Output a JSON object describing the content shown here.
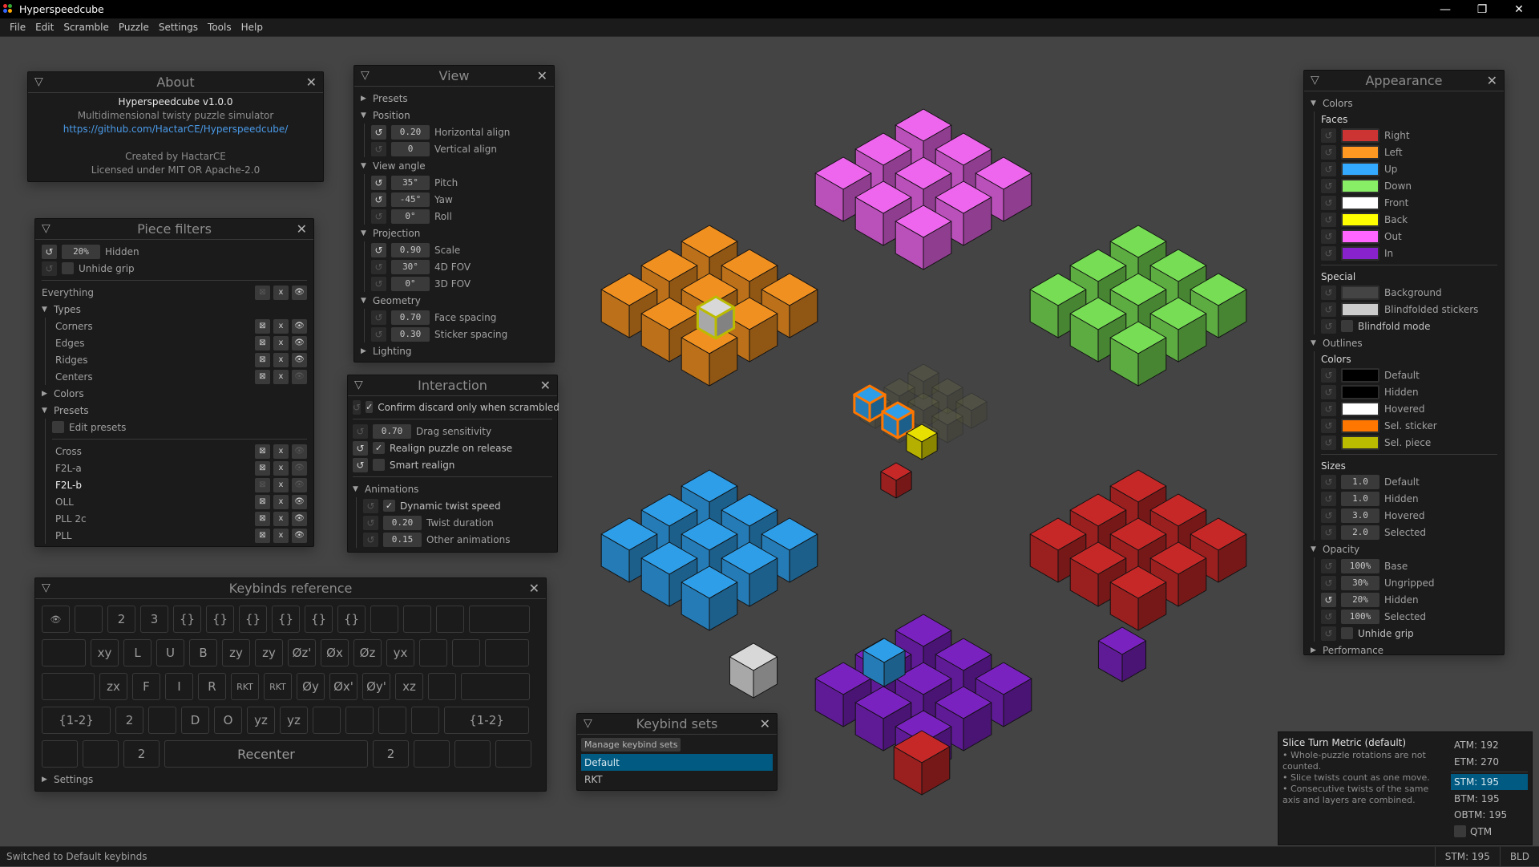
{
  "window": {
    "title": "Hyperspeedcube",
    "controls": {
      "minimize": "—",
      "restore": "❐",
      "close": "✕"
    }
  },
  "menu": [
    "File",
    "Edit",
    "Scramble",
    "Puzzle",
    "Settings",
    "Tools",
    "Help"
  ],
  "about": {
    "title": "About",
    "app_version": "Hyperspeedcube v1.0.0",
    "tagline": "Multidimensional twisty puzzle simulator",
    "link": "https://github.com/HactarCE/Hyperspeedcube/",
    "credit": "Created by HactarCE",
    "license": "Licensed under MIT OR Apache-2.0"
  },
  "piece_filters": {
    "title": "Piece filters",
    "hidden_opacity": "20%",
    "hidden_label": "Hidden",
    "unhide_grip_label": "Unhide grip",
    "everything_label": "Everything",
    "types_label": "Types",
    "types": [
      {
        "label": "Corners",
        "eye_enabled": true
      },
      {
        "label": "Edges",
        "eye_enabled": true
      },
      {
        "label": "Ridges",
        "eye_enabled": true
      },
      {
        "label": "Centers",
        "eye_enabled": false
      }
    ],
    "colors_label": "Colors",
    "presets_label": "Presets",
    "edit_presets_label": "Edit presets",
    "presets": [
      {
        "label": "Cross",
        "eye_enabled": false,
        "active": false
      },
      {
        "label": "F2L-a",
        "eye_enabled": false,
        "active": false
      },
      {
        "label": "F2L-b",
        "eye_enabled": false,
        "active": true
      },
      {
        "label": "OLL",
        "eye_enabled": true,
        "active": false
      },
      {
        "label": "PLL 2c",
        "eye_enabled": true,
        "active": false
      },
      {
        "label": "PLL",
        "eye_enabled": true,
        "active": false
      }
    ]
  },
  "view": {
    "title": "View",
    "presets_label": "Presets",
    "position_label": "Position",
    "horizontal_align": {
      "value": "0.20",
      "label": "Horizontal align"
    },
    "vertical_align": {
      "value": "0",
      "label": "Vertical align"
    },
    "view_angle_label": "View angle",
    "pitch": {
      "value": "35°",
      "label": "Pitch"
    },
    "yaw": {
      "value": "-45°",
      "label": "Yaw"
    },
    "roll": {
      "value": "0°",
      "label": "Roll"
    },
    "projection_label": "Projection",
    "scale": {
      "value": "0.90",
      "label": "Scale"
    },
    "fov4d": {
      "value": "30°",
      "label": "4D FOV"
    },
    "fov3d": {
      "value": "0°",
      "label": "3D FOV"
    },
    "geometry_label": "Geometry",
    "face_spacing": {
      "value": "0.70",
      "label": "Face spacing"
    },
    "sticker_spacing": {
      "value": "0.30",
      "label": "Sticker spacing"
    },
    "lighting_label": "Lighting"
  },
  "interaction": {
    "title": "Interaction",
    "confirm_discard": {
      "label": "Confirm discard only when scrambled",
      "checked": true
    },
    "drag_sensitivity": {
      "value": "0.70",
      "label": "Drag sensitivity"
    },
    "realign": {
      "label": "Realign puzzle on release",
      "checked": true
    },
    "smart_realign": {
      "label": "Smart realign",
      "checked": false
    },
    "animations_label": "Animations",
    "dynamic_twist": {
      "label": "Dynamic twist speed",
      "checked": true
    },
    "twist_duration": {
      "value": "0.20",
      "label": "Twist duration"
    },
    "other_animations": {
      "value": "0.15",
      "label": "Other animations"
    }
  },
  "keybinds_reference": {
    "title": "Keybinds reference",
    "rows": [
      [
        "👁",
        "",
        "2",
        "3",
        "{}",
        "{}",
        "{}",
        "{}",
        "{}",
        "{}",
        "",
        "",
        "",
        ""
      ],
      [
        "",
        "xy",
        "L",
        "U",
        "B",
        "zy",
        "zy",
        "Øz'",
        "Øx",
        "Øz",
        "yx",
        "",
        "",
        ""
      ],
      [
        "",
        "zx",
        "F",
        "I",
        "R",
        "RKT",
        "RKT",
        "Øy",
        "Øx'",
        "Øy'",
        "xz",
        "",
        ""
      ],
      [
        "{1-2}",
        "2",
        "",
        "D",
        "O",
        "yz",
        "yz",
        "",
        "",
        "",
        "",
        "{1-2}"
      ],
      [
        "",
        "",
        "2",
        "Recenter",
        "2",
        "",
        "",
        ""
      ]
    ],
    "settings_label": "Settings"
  },
  "keybind_sets": {
    "title": "Keybind sets",
    "manage_label": "Manage keybind sets",
    "items": [
      {
        "label": "Default",
        "selected": true
      },
      {
        "label": "RKT",
        "selected": false
      }
    ]
  },
  "appearance": {
    "title": "Appearance",
    "colors_label": "Colors",
    "faces_label": "Faces",
    "faces": [
      {
        "label": "Right",
        "color": "#cc3333"
      },
      {
        "label": "Left",
        "color": "#ff9922"
      },
      {
        "label": "Up",
        "color": "#33aaff"
      },
      {
        "label": "Down",
        "color": "#88ee66"
      },
      {
        "label": "Front",
        "color": "#ffffff"
      },
      {
        "label": "Back",
        "color": "#ffff00"
      },
      {
        "label": "Out",
        "color": "#ff66ff"
      },
      {
        "label": "In",
        "color": "#8822cc"
      }
    ],
    "special_label": "Special",
    "special": [
      {
        "label": "Background",
        "color": "#444444"
      },
      {
        "label": "Blindfolded stickers",
        "color": "#cccccc"
      }
    ],
    "blindfold_label": "Blindfold mode",
    "outlines_label": "Outlines",
    "outline_colors_label": "Colors",
    "outline_colors": [
      {
        "label": "Default",
        "color": "#000000"
      },
      {
        "label": "Hidden",
        "color": "#000000"
      },
      {
        "label": "Hovered",
        "color": "#ffffff"
      },
      {
        "label": "Sel. sticker",
        "color": "#ff7700"
      },
      {
        "label": "Sel. piece",
        "color": "#bbbb00"
      }
    ],
    "sizes_label": "Sizes",
    "sizes": [
      {
        "value": "1.0",
        "label": "Default"
      },
      {
        "value": "1.0",
        "label": "Hidden"
      },
      {
        "value": "3.0",
        "label": "Hovered"
      },
      {
        "value": "2.0",
        "label": "Selected"
      }
    ],
    "opacity_label": "Opacity",
    "opacity": [
      {
        "value": "100%",
        "label": "Base",
        "modified": false
      },
      {
        "value": "30%",
        "label": "Ungripped",
        "modified": false
      },
      {
        "value": "20%",
        "label": "Hidden",
        "modified": true
      },
      {
        "value": "100%",
        "label": "Selected",
        "modified": false
      }
    ],
    "unhide_grip_label": "Unhide grip",
    "performance_label": "Performance"
  },
  "metric_tooltip": {
    "title": "Slice Turn Metric (default)",
    "bullets": [
      "• Whole-puzzle rotations are not counted.",
      "• Slice twists count as one move.",
      "• Consecutive twists of the same axis and layers are combined."
    ],
    "metrics": [
      {
        "label": "ATM: 192",
        "selected": false
      },
      {
        "label": "ETM: 270",
        "selected": false
      },
      {
        "label": "STM: 195",
        "selected": true
      },
      {
        "label": "BTM: 195",
        "selected": false
      },
      {
        "label": "OBTM: 195",
        "selected": false
      }
    ],
    "qtm_label": "QTM"
  },
  "status_bar": {
    "message": "Switched to Default keybinds",
    "metric": "STM: 195",
    "mode": "BLD"
  },
  "puzzle": {
    "face_colors": {
      "out": "#ee66ee",
      "left": "#f09020",
      "down": "#77dd55",
      "up": "#2f9ee8",
      "right": "#c62828",
      "in": "#7a22c0",
      "front": "#d8d8d8",
      "back": "#e8e000"
    }
  }
}
